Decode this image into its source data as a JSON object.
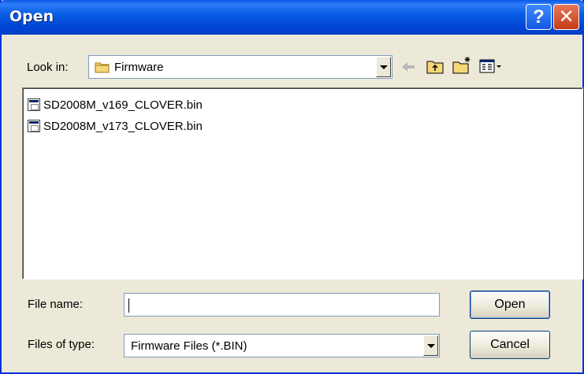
{
  "window": {
    "title": "Open"
  },
  "titlebar_buttons": {
    "help": "?",
    "close": "✕"
  },
  "look_in": {
    "label": "Look in:",
    "folder": "Firmware"
  },
  "toolbar": {
    "icons": [
      "back-arrow-icon",
      "up-folder-icon",
      "new-folder-icon",
      "view-menu-icon"
    ]
  },
  "files": [
    {
      "name": "SD2008M_v169_CLOVER.bin",
      "icon": "binary-file-icon"
    },
    {
      "name": "SD2008M_v173_CLOVER.bin",
      "icon": "binary-file-icon"
    }
  ],
  "file_name": {
    "label": "File name:",
    "value": ""
  },
  "file_type": {
    "label": "Files of type:",
    "value": "Firmware Files (*.BIN)"
  },
  "buttons": {
    "open": "Open",
    "cancel": "Cancel"
  },
  "colors": {
    "titlebar": "#0054e3",
    "window_bg": "#ece9d8",
    "close_button": "#d9532c"
  }
}
